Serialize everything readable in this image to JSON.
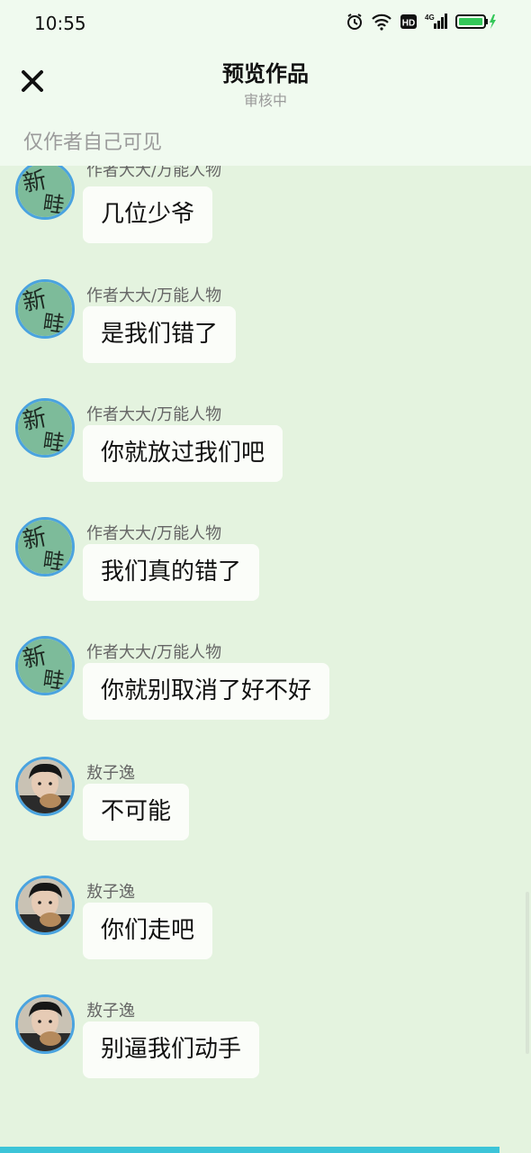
{
  "status_bar": {
    "time": "10:55",
    "icons": [
      "alarm-icon",
      "wifi-icon",
      "hd-icon",
      "signal-4g-icon",
      "battery-charging-icon"
    ],
    "hd_label": "HD",
    "network_label": "4G",
    "battery_color": "#34c759"
  },
  "header": {
    "close_icon": "close-icon",
    "title": "预览作品",
    "subtitle": "审核中",
    "visibility_note": "仅作者自己可见"
  },
  "messages": [
    {
      "sender": "作者大大/万能人物",
      "text": "几位少爷",
      "avatar": "xinlei-avatar"
    },
    {
      "sender": "作者大大/万能人物",
      "text": "是我们错了",
      "avatar": "xinlei-avatar"
    },
    {
      "sender": "作者大大/万能人物",
      "text": "你就放过我们吧",
      "avatar": "xinlei-avatar"
    },
    {
      "sender": "作者大大/万能人物",
      "text": "我们真的错了",
      "avatar": "xinlei-avatar"
    },
    {
      "sender": "作者大大/万能人物",
      "text": "你就别取消了好不好",
      "avatar": "xinlei-avatar"
    },
    {
      "sender": "敖子逸",
      "text": "不可能",
      "avatar": "person-photo-avatar"
    },
    {
      "sender": "敖子逸",
      "text": "你们走吧",
      "avatar": "person-photo-avatar"
    },
    {
      "sender": "敖子逸",
      "text": "别逼我们动手",
      "avatar": "person-photo-avatar"
    }
  ],
  "avatar_glyphs": {
    "top": "新",
    "bottom": "畦"
  },
  "colors": {
    "background": "#e4f3df",
    "header": "#f0faef",
    "bubble": "#fbfdf9",
    "avatar_border": "#4aa3df",
    "avatar_green": "#7dbb9a",
    "bottom_bar": "#3cc4d8"
  }
}
